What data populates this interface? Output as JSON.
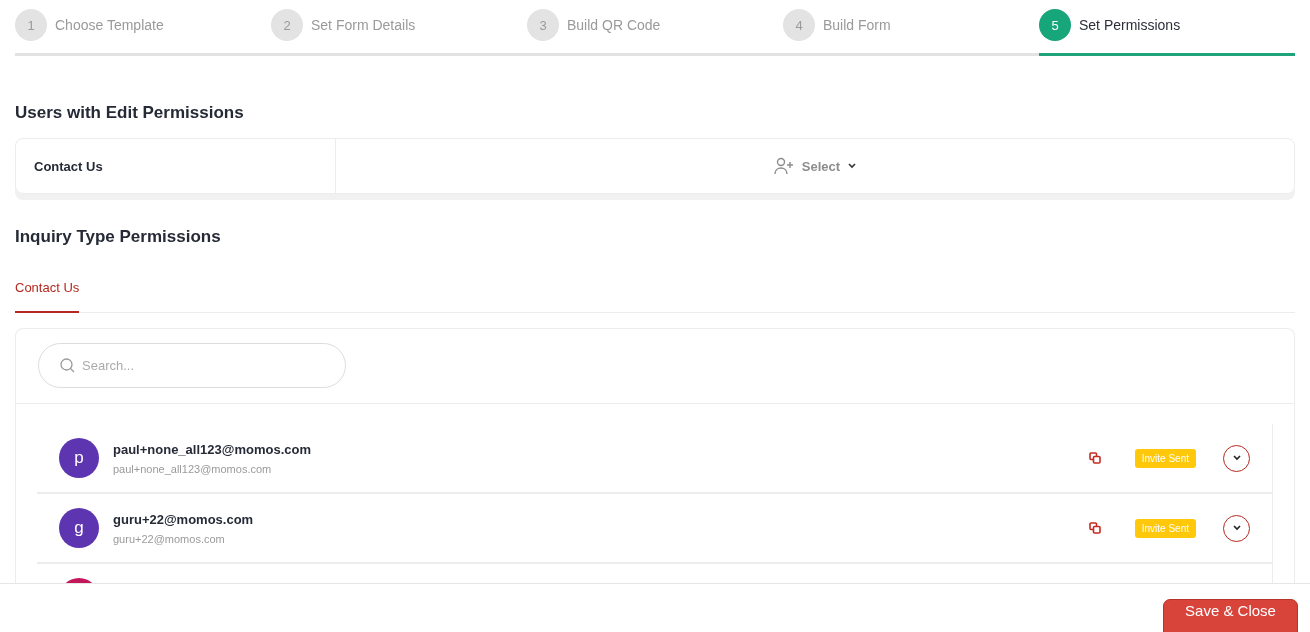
{
  "steps": [
    {
      "number": "1",
      "label": "Choose Template",
      "selected": false
    },
    {
      "number": "2",
      "label": "Set Form Details",
      "selected": false
    },
    {
      "number": "3",
      "label": "Build QR Code",
      "selected": false
    },
    {
      "number": "4",
      "label": "Build Form",
      "selected": false
    },
    {
      "number": "5",
      "label": "Set Permissions",
      "selected": true
    }
  ],
  "edit_permissions": {
    "title": "Users with Edit Permissions",
    "form_name": "Contact Us",
    "select_label": "Select"
  },
  "inquiry_permissions": {
    "title": "Inquiry Type Permissions",
    "tabs": [
      {
        "label": "Contact Us",
        "selected": true
      }
    ],
    "search": {
      "placeholder": "Search..."
    },
    "users": [
      {
        "initial": "p",
        "name": "paul+none_all123@momos.com",
        "email": "paul+none_all123@momos.com",
        "status": "Invite Sent",
        "color": "#5e35b1"
      },
      {
        "initial": "g",
        "name": "guru+22@momos.com",
        "email": "guru+22@momos.com",
        "status": "Invite Sent",
        "color": "#5e35b1"
      },
      {
        "color": "#c2185b"
      }
    ]
  },
  "footer": {
    "save_label": "Save & Close"
  }
}
